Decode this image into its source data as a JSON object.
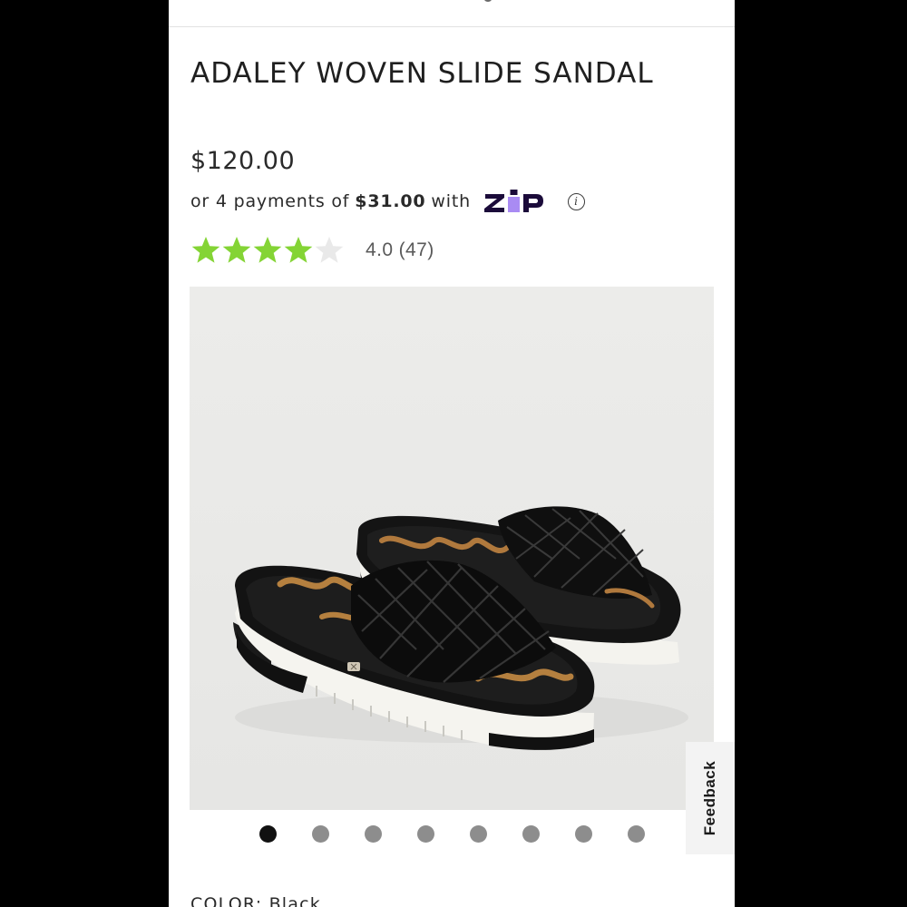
{
  "product": {
    "title": "ADALEY WOVEN SLIDE SANDAL",
    "price": "$120.00",
    "installment": {
      "prefix": "or 4 payments of",
      "amount": "$31.00",
      "suffix": "with",
      "provider_logo": "zip",
      "provider_color": "#a98bf3",
      "info_icon": "info-icon"
    },
    "rating": {
      "value": 4.0,
      "max": 5,
      "display": "4.0",
      "count": "(47)",
      "star_filled_color": "#84d435",
      "star_empty_color": "#e9e9e9"
    },
    "image": {
      "alt": "Black woven leather slide sandals with white platform soles",
      "background": "#ebebe9"
    },
    "carousel": {
      "count": 8,
      "active_index": 0
    },
    "color": {
      "label": "COLOR:",
      "value": "Black"
    }
  },
  "feedback": {
    "label": "Feedback"
  }
}
